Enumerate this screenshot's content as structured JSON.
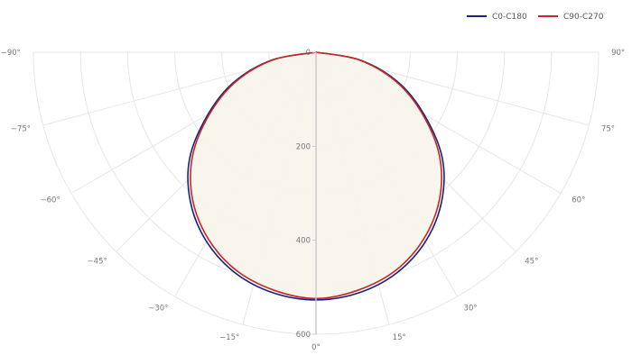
{
  "chart_data": {
    "type": "polar",
    "title": "",
    "angle_ticks": [
      {
        "deg": -90,
        "label": "−90°"
      },
      {
        "deg": -75,
        "label": "−75°"
      },
      {
        "deg": -60,
        "label": "−60°"
      },
      {
        "deg": -45,
        "label": "−45°"
      },
      {
        "deg": -30,
        "label": "−30°"
      },
      {
        "deg": -15,
        "label": "−15°"
      },
      {
        "deg": 0,
        "label": "0°"
      },
      {
        "deg": 15,
        "label": "15°"
      },
      {
        "deg": 30,
        "label": "30°"
      },
      {
        "deg": 45,
        "label": "45°"
      },
      {
        "deg": 60,
        "label": "60°"
      },
      {
        "deg": 75,
        "label": "75°"
      },
      {
        "deg": 90,
        "label": "90°"
      }
    ],
    "radial_ticks": [
      {
        "value": 0,
        "label": "0"
      },
      {
        "value": 200,
        "label": "200"
      },
      {
        "value": 400,
        "label": "400"
      },
      {
        "value": 600,
        "label": "600"
      }
    ],
    "radial_range": [
      0,
      600
    ],
    "angle_range": [
      -90,
      90
    ],
    "grid": true,
    "legend_position": "top-right",
    "series": [
      {
        "name": "C0-C180",
        "color": "#1a237e",
        "angles": [
          -90,
          -80,
          -70,
          -60,
          -50,
          -40,
          -30,
          -20,
          -10,
          0,
          10,
          20,
          30,
          40,
          50,
          60,
          70,
          80,
          90
        ],
        "values": [
          0,
          95,
          185,
          265,
          350,
          415,
          465,
          500,
          520,
          527,
          520,
          500,
          465,
          415,
          350,
          265,
          185,
          95,
          0
        ]
      },
      {
        "name": "C90-C270",
        "color": "#c62828",
        "angles": [
          -90,
          -80,
          -70,
          -60,
          -50,
          -40,
          -30,
          -20,
          -10,
          0,
          10,
          20,
          30,
          40,
          50,
          60,
          70,
          80,
          90
        ],
        "values": [
          0,
          92,
          180,
          260,
          342,
          408,
          458,
          494,
          514,
          524,
          514,
          494,
          458,
          408,
          342,
          260,
          180,
          92,
          0
        ]
      }
    ]
  }
}
